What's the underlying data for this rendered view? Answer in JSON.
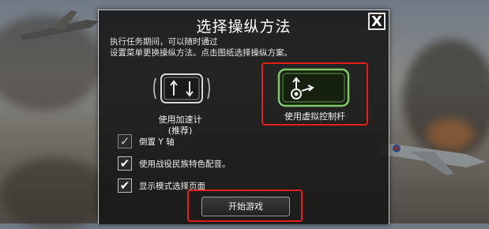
{
  "dialog": {
    "title": "选择操纵方法",
    "close_label": "X",
    "description_line1": "执行任务期间，可以随时通过",
    "description_line2": "设置菜单更换操纵方法。点击图纸选择操纵方案。"
  },
  "schemes": [
    {
      "label_line1": "使用加速计",
      "label_line2": "(推荐)",
      "icon": "tilt-phone-icon",
      "selected": false
    },
    {
      "label_line1": "使用虚拟控制杆",
      "label_line2": "",
      "icon": "virtual-joystick-phone-icon",
      "selected": true
    }
  ],
  "options": [
    {
      "label": "倒置 Y 轴",
      "checked": true,
      "check_glyph": "✓"
    },
    {
      "label": "使用战役民族特色配音。",
      "checked": true,
      "check_glyph": "✔"
    },
    {
      "label": "显示模式选择页面",
      "checked": true,
      "check_glyph": "✔"
    }
  ],
  "start_button": {
    "label": "开始游戏"
  },
  "colors": {
    "highlight": "#e31e1e",
    "joystick_green": "#7fc86a",
    "panel_bg": "#161616"
  }
}
